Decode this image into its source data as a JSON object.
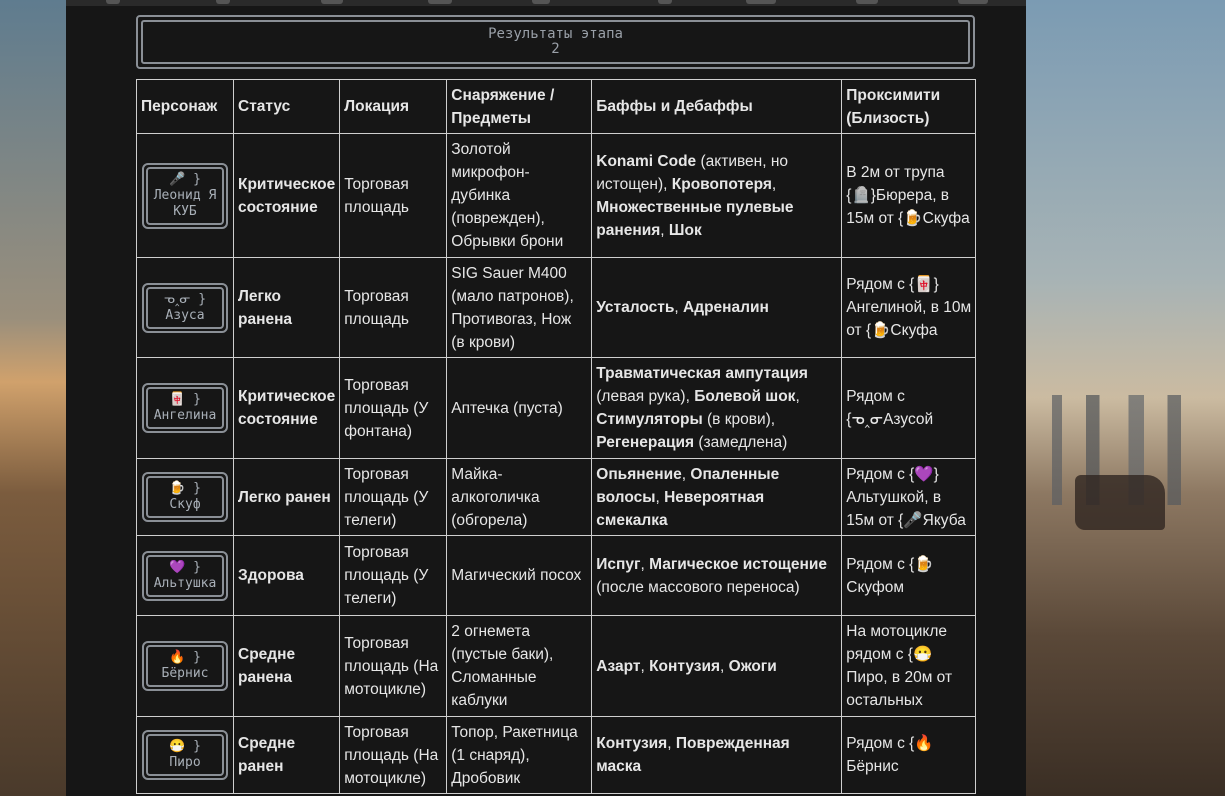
{
  "stage": {
    "title": "Результаты этапа",
    "number": "2"
  },
  "table": {
    "headers": [
      "Персонаж",
      "Статус",
      "Локация",
      "Снаряжение / Предметы",
      "Баффы и Дебаффы",
      "Проксимити (Близость)"
    ],
    "rows": [
      {
        "badge_icon": "🎤 }",
        "badge_name": "Леонид ЯКУБ",
        "status": "Критическое состояние",
        "location": "Торговая площадь",
        "gear": "Золотой микрофон-дубинка (поврежден), Обрывки брони",
        "buffs": [
          {
            "text": "Konami Code",
            "bold": true
          },
          {
            "text": " (активен, но истощен), ",
            "bold": false
          },
          {
            "text": "Кровопотеря",
            "bold": true
          },
          {
            "text": ", ",
            "bold": false
          },
          {
            "text": "Множественные пулевые ранения",
            "bold": true
          },
          {
            "text": ", ",
            "bold": false
          },
          {
            "text": "Шок",
            "bold": true
          }
        ],
        "proximity": "В 2м от трупа {🪦}Бюрера, в 15м от {🍺Скуфа"
      },
      {
        "badge_icon": "ᓀ‸ᓂ }",
        "badge_name": "Азуса",
        "status": "Легко ранена",
        "location": "Торговая площадь",
        "gear": "SIG Sauer M400 (мало патронов), Противогаз, Нож (в крови)",
        "buffs": [
          {
            "text": "Усталость",
            "bold": true
          },
          {
            "text": ", ",
            "bold": false
          },
          {
            "text": "Адреналин",
            "bold": true
          }
        ],
        "proximity": "Рядом с {🀄} Ангелиной, в 10м от {🍺Скуфа"
      },
      {
        "badge_icon": "🀄 }",
        "badge_name": "Ангелина",
        "status": "Критическое состояние",
        "location": "Торговая площадь (У фонтана)",
        "gear": "Аптечка (пуста)",
        "buffs": [
          {
            "text": "Травматическая ампутация",
            "bold": true
          },
          {
            "text": " (левая рука), ",
            "bold": false
          },
          {
            "text": "Болевой шок",
            "bold": true
          },
          {
            "text": ", ",
            "bold": false
          },
          {
            "text": "Стимуляторы",
            "bold": true
          },
          {
            "text": " (в крови), ",
            "bold": false
          },
          {
            "text": "Регенерация",
            "bold": true
          },
          {
            "text": " (замедлена)",
            "bold": false
          }
        ],
        "proximity": "Рядом с {ᓀ‸ᓂАзусой"
      },
      {
        "badge_icon": "🍺 }",
        "badge_name": "Скуф",
        "status": "Легко ранен",
        "location": "Торговая площадь (У телеги)",
        "gear": "Майка-алкоголичка (обгорела)",
        "buffs": [
          {
            "text": "Опьянение",
            "bold": true
          },
          {
            "text": ", ",
            "bold": false
          },
          {
            "text": "Опаленные волосы",
            "bold": true
          },
          {
            "text": ", ",
            "bold": false
          },
          {
            "text": "Невероятная смекалка",
            "bold": true
          }
        ],
        "proximity": "Рядом с {💜} Альтушкой, в 15м от {🎤Якуба"
      },
      {
        "badge_icon": "💜 }",
        "badge_name": "Альтушка",
        "status": "Здорова",
        "location": "Торговая площадь (У телеги)",
        "gear": "Магический посох",
        "buffs": [
          {
            "text": "Испуг",
            "bold": true
          },
          {
            "text": ", ",
            "bold": false
          },
          {
            "text": "Магическое истощение",
            "bold": true
          },
          {
            "text": " (после массового переноса)",
            "bold": false
          }
        ],
        "proximity": "Рядом с {🍺 Скуфом"
      },
      {
        "badge_icon": "🔥 }",
        "badge_name": "Бёрнис",
        "status": "Средне ранена",
        "location": "Торговая площадь (На мотоцикле)",
        "gear": "2 огнемета (пустые баки), Сломанные каблуки",
        "buffs": [
          {
            "text": "Азарт",
            "bold": true
          },
          {
            "text": ", ",
            "bold": false
          },
          {
            "text": "Контузия",
            "bold": true
          },
          {
            "text": ", ",
            "bold": false
          },
          {
            "text": "Ожоги",
            "bold": true
          }
        ],
        "proximity": "На мотоцикле рядом с {😷 Пиро, в 20м от остальных"
      },
      {
        "badge_icon": "😷 }",
        "badge_name": "Пиро",
        "status": "Средне ранен",
        "location": "Торговая площадь (На мотоцикле)",
        "gear": "Топор, Ракетница (1 снаряд), Дробовик",
        "buffs": [
          {
            "text": "Контузия",
            "bold": true
          },
          {
            "text": ", ",
            "bold": false
          },
          {
            "text": "Поврежденная маска",
            "bold": true
          }
        ],
        "proximity": "Рядом с {🔥 Бёрнис"
      }
    ]
  }
}
